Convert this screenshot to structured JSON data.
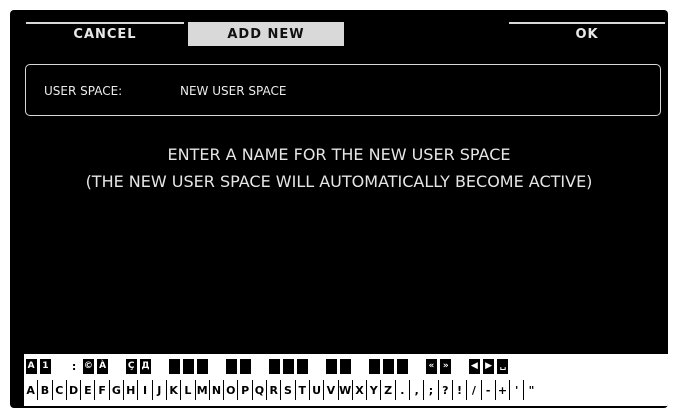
{
  "header": {
    "cancel_label": "CANCEL",
    "add_new_label": "ADD NEW",
    "ok_label": "OK"
  },
  "name_field": {
    "label": "USER SPACE:",
    "value": "NEW USER SPACE"
  },
  "message": {
    "line1": "ENTER A NAME FOR THE NEW USER SPACE",
    "line2": "(THE NEW USER SPACE WILL AUTOMATICALLY BECOME ACTIVE)"
  },
  "keyboard": {
    "upper_keys": [
      "A",
      "1",
      "",
      ":",
      "©",
      "À",
      "",
      "Ç",
      "Д",
      "",
      "",
      "",
      "",
      "",
      "",
      "",
      "",
      "",
      "",
      "",
      "",
      "",
      "",
      "",
      "",
      "",
      "",
      "",
      "«",
      "»",
      "",
      "◀",
      "▶",
      "␣",
      "",
      ""
    ],
    "lower_keys": [
      "A",
      "B",
      "C",
      "D",
      "E",
      "F",
      "G",
      "H",
      "I",
      "J",
      "K",
      "L",
      "M",
      "N",
      "O",
      "P",
      "Q",
      "R",
      "S",
      "T",
      "U",
      "V",
      "W",
      "X",
      "Y",
      "Z",
      ".",
      ",",
      ";",
      "?",
      "!",
      "/",
      "-",
      "+",
      "'",
      "\""
    ]
  }
}
